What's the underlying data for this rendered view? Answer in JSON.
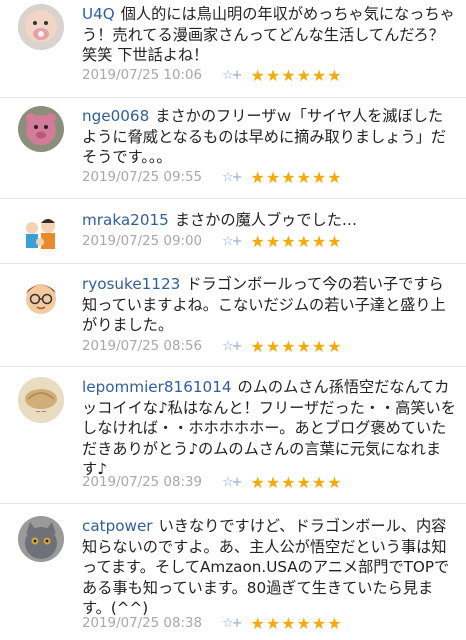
{
  "comments": [
    {
      "user": "U4Q",
      "text": "個人的には鳥山明の年収がめっちゃ気になっちゃう！売れてる漫画家さんってどんな生活してんだろ？笑笑 下世話よね！",
      "timestamp": "2019/07/25 10:06",
      "reply_icon": "☆+",
      "stars": "★★★★★★",
      "avatar": "baby-with-pacifier"
    },
    {
      "user": "nge0068",
      "text": "まさかのフリーザｗ「サイヤ人を滅ぼしたように脅威となるものは早めに摘み取りましょう」だそうです。。。",
      "timestamp": "2019/07/25 09:55",
      "reply_icon": "☆+",
      "stars": "★★★★★★",
      "avatar": "pink-bear-toy"
    },
    {
      "user": "mraka2015",
      "text": "まさかの魔人ブゥでした…",
      "timestamp": "2019/07/25 09:00",
      "reply_icon": "☆+",
      "stars": "★★★★★★",
      "avatar": "family-illustration"
    },
    {
      "user": "ryosuke1123",
      "text": "ドラゴンボールって今の若い子ですら知っていますよね。こないだジムの若い子達と盛り上がりました。",
      "timestamp": "2019/07/25 08:56",
      "reply_icon": "☆+",
      "stars": "★★★★★★",
      "avatar": "cartoon-man-glasses"
    },
    {
      "user": "lepommier8161014",
      "text": "のムのムさん孫悟空だなんてカッコイイな♪私はなんと！フリーザだった・・高笑いをしなければ・・ホホホホホー。あとブログ褒めていただきありがとう♪のムのムさんの言葉に元気になれます♪",
      "timestamp": "2019/07/25 08:39",
      "reply_icon": "☆+",
      "stars": "★★★★★★",
      "avatar": "bread-logo"
    },
    {
      "user": "catpower",
      "text": "いきなりですけど、ドラゴンボール、内容知らないのですよ。あ、主人公が悟空だという事は知ってます。そしてAmzaon.USAのアニメ部門でTOPである事も知っています。80過ぎて生きていたら見ます。(^^)",
      "timestamp": "2019/07/25 08:38",
      "reply_icon": "☆+",
      "stars": "★★★★★★",
      "avatar": "grey-cat"
    }
  ]
}
